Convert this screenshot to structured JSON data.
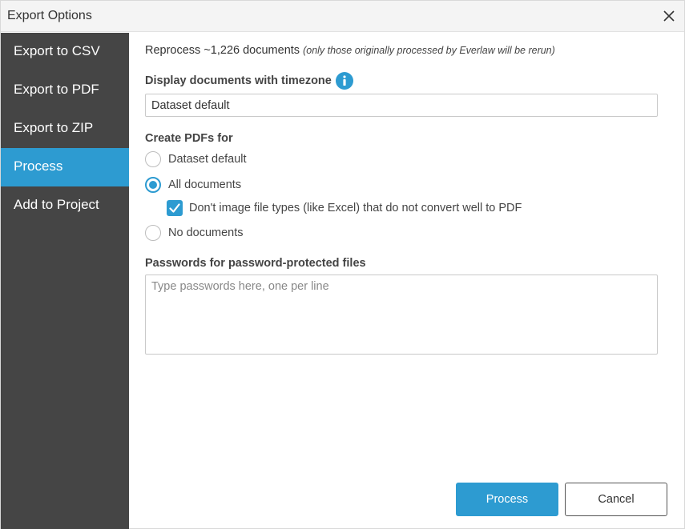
{
  "dialog": {
    "title": "Export Options"
  },
  "sidebar": {
    "items": [
      {
        "label": "Export to CSV"
      },
      {
        "label": "Export to PDF"
      },
      {
        "label": "Export to ZIP"
      },
      {
        "label": "Process",
        "active": true
      },
      {
        "label": "Add to Project"
      }
    ]
  },
  "main": {
    "reprocess_text": "Reprocess ~1,226 documents",
    "reprocess_note": "(only those originally processed by Everlaw will be rerun)",
    "timezone_label": "Display documents with timezone",
    "timezone_value": "Dataset default",
    "create_pdfs_label": "Create PDFs for",
    "pdf_options": [
      {
        "label": "Dataset default",
        "checked": false
      },
      {
        "label": "All documents",
        "checked": true
      },
      {
        "label": "No documents",
        "checked": false
      }
    ],
    "dont_image_label": "Don't image file types (like Excel) that do not convert well to PDF",
    "dont_image_checked": true,
    "passwords_label": "Passwords for password-protected files",
    "passwords_placeholder": "Type passwords here, one per line"
  },
  "footer": {
    "process_label": "Process",
    "cancel_label": "Cancel"
  },
  "colors": {
    "accent": "#2d9bd1",
    "sidebar_bg": "#454545"
  },
  "icons": {
    "close": "close-icon",
    "info": "info-icon",
    "check": "checkmark-icon"
  }
}
